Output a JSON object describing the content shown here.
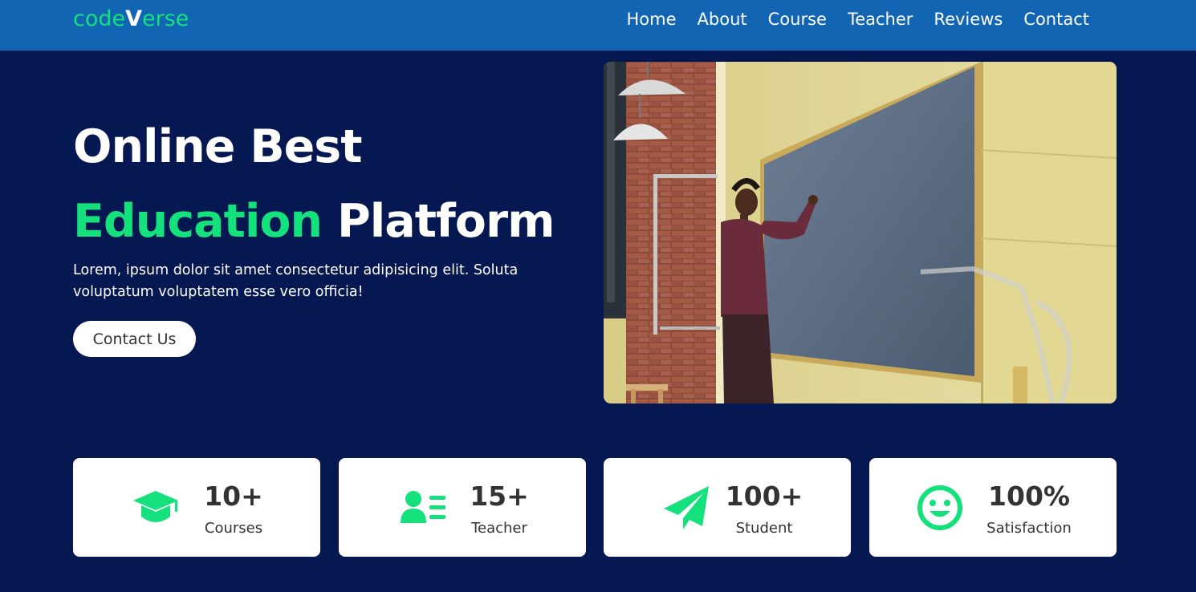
{
  "brand": {
    "logo_prefix": "code",
    "logo_v": "V",
    "logo_suffix": "erse"
  },
  "nav": {
    "items": [
      {
        "label": "Home"
      },
      {
        "label": "About"
      },
      {
        "label": "Course"
      },
      {
        "label": "Teacher"
      },
      {
        "label": "Reviews"
      },
      {
        "label": "Contact"
      }
    ]
  },
  "hero": {
    "title_line1": "Online Best",
    "title_accent": "Education",
    "title_rest": "Platform",
    "description": "Lorem, ipsum dolor sit amet consectetur adipisicing elit. Soluta voluptatum voluptatem esse vero officia!",
    "cta_label": "Contact Us",
    "image_icon": "teacher-at-chalkboard-photo"
  },
  "stats": [
    {
      "value": "10+",
      "label": "Courses",
      "icon": "graduation-cap-icon"
    },
    {
      "value": "15+",
      "label": "Teacher",
      "icon": "teacher-list-icon"
    },
    {
      "value": "100+",
      "label": "Student",
      "icon": "paper-plane-icon"
    },
    {
      "value": "100%",
      "label": "Satisfaction",
      "icon": "smile-icon"
    }
  ],
  "colors": {
    "navbar": "#1265b3",
    "background": "#061852",
    "accent": "#14e07c",
    "text_light": "#ffffff",
    "text_dark": "#333333"
  }
}
